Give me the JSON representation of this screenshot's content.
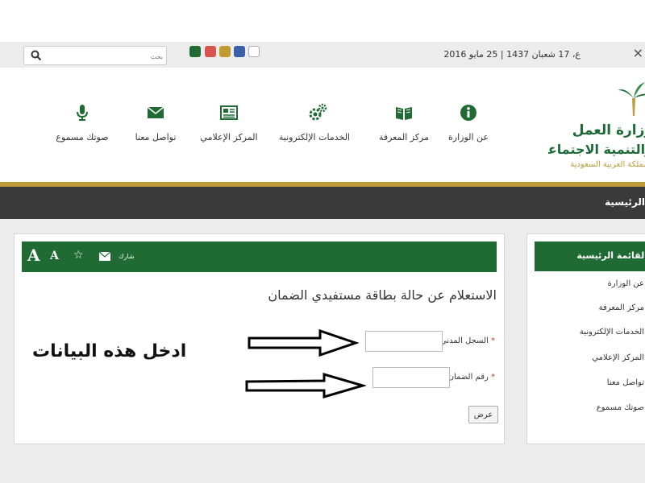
{
  "topbar": {
    "search": {
      "placeholder": "بحث"
    },
    "theme_colors": [
      {
        "name": "green",
        "color": "#1f6b33"
      },
      {
        "name": "red",
        "color": "#d9534f"
      },
      {
        "name": "gold",
        "color": "#c29a2e"
      },
      {
        "name": "blue",
        "color": "#3b5fa8"
      },
      {
        "name": "white",
        "color": "#ffffff"
      }
    ],
    "date": "ع، 17 شعبان 1437 | 25 مايو 2016",
    "close_glyph": "×"
  },
  "header": {
    "logo": {
      "line1": "وزارة العمل",
      "line2": "والتنمية الاجتماعية",
      "line3": "المملكة العربية السعودية"
    },
    "nav": [
      {
        "label": "عن الوزارة",
        "icon": "info-icon"
      },
      {
        "label": "مركز المعرفة",
        "icon": "book-icon"
      },
      {
        "label": "الخدمات الإلكترونية",
        "icon": "gears-icon"
      },
      {
        "label": "المركز الإعلامي",
        "icon": "newspaper-icon"
      },
      {
        "label": "تواصل معنا",
        "icon": "envelope-icon"
      },
      {
        "label": "صوتك مسموع",
        "icon": "microphone-icon"
      }
    ]
  },
  "darkbar": {
    "text": "الرئيسية"
  },
  "main": {
    "toolbar": {
      "font_large": "A",
      "font_small": "A",
      "share_label": "شارك"
    },
    "title": "الاستعلام عن حالة بطاقة مستفيدي الضمان",
    "fields": [
      {
        "label": "السجل المدني",
        "required": "*",
        "value": ""
      },
      {
        "label": "رقم الضمان",
        "required": "*",
        "value": ""
      }
    ],
    "submit_label": "عرض",
    "annotation": "ادخل هذه البيانات"
  },
  "sidebar": {
    "title": "القائمة الرئيسية",
    "items": [
      "عن الوزارة",
      "مركز المعرفة",
      "الخدمات الإلكترونية",
      "المركز الإعلامي",
      "تواصل معنا",
      "صوتك مسموع"
    ]
  }
}
